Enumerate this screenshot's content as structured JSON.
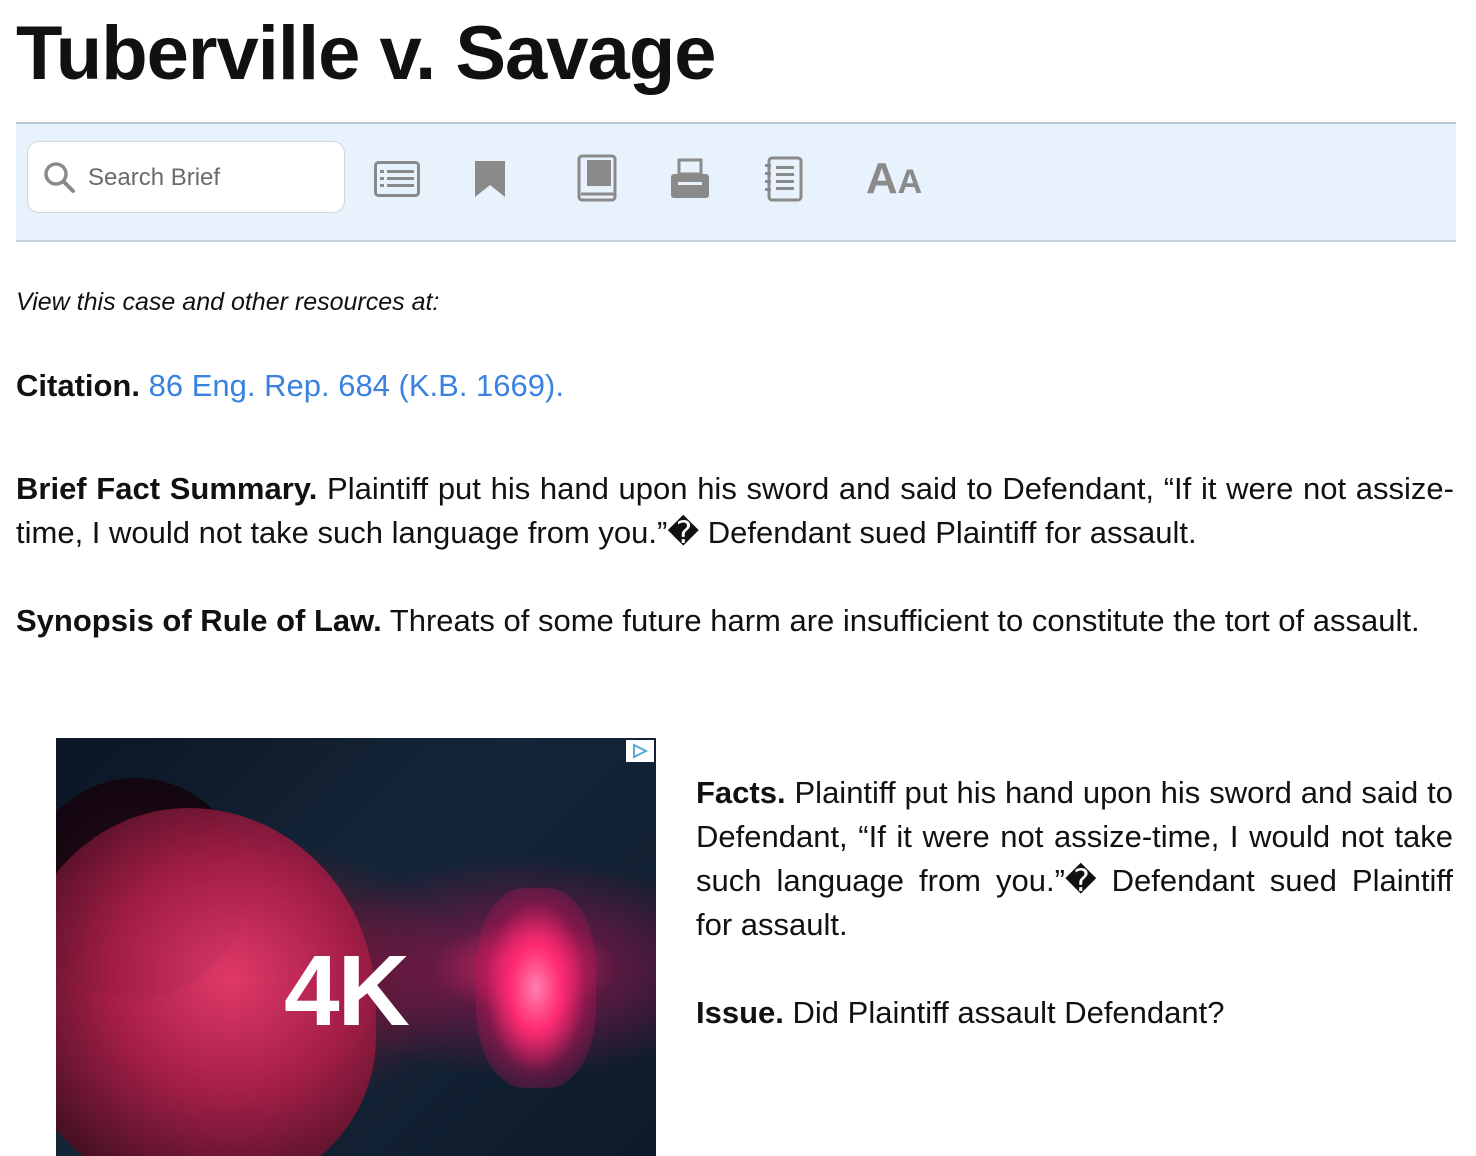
{
  "page": {
    "title": "Tuberville v. Savage"
  },
  "toolbar": {
    "search": {
      "placeholder": "Search Brief",
      "icon": "search-icon"
    },
    "buttons": [
      {
        "name": "outline-button",
        "icon": "list-icon"
      },
      {
        "name": "bookmark-button",
        "icon": "bookmark-icon"
      },
      {
        "name": "book-button",
        "icon": "book-icon"
      },
      {
        "name": "print-button",
        "icon": "printer-icon"
      },
      {
        "name": "notes-button",
        "icon": "notebook-icon"
      },
      {
        "name": "font-size-button",
        "icon": "font-size-icon",
        "label_big": "A",
        "label_small": "A"
      }
    ],
    "colors": {
      "background": "#e8f2fc",
      "icon": "#8a8a8a"
    }
  },
  "content": {
    "view_resources": "View this case and other resources at:",
    "citation": {
      "label": "Citation.",
      "value": "86 Eng. Rep. 684 (K.B. 1669).",
      "link_color": "#3b82e0"
    },
    "brief_fact_summary": {
      "label": "Brief Fact Summary.",
      "text": "Plaintiff put his hand upon his sword and said to Defendant, “If it were not assize-time, I would not take such language from you.”� Defendant sued Plaintiff for assault."
    },
    "synopsis": {
      "label": "Synopsis of Rule of Law.",
      "text": "Threats of some future harm are insufficient to constitute the tort of assault."
    },
    "facts": {
      "label": "Facts.",
      "text": "Plaintiff put his hand upon his sword and said to Defendant, “If it were not assize-time, I would not take such language from you.”� Defendant sued Plaintiff for assault."
    },
    "issue": {
      "label": "Issue.",
      "text": "Did Plaintiff assault Defendant?"
    }
  },
  "ad": {
    "overlay_text": "4K",
    "adchoices_icon": "adchoices-icon"
  }
}
